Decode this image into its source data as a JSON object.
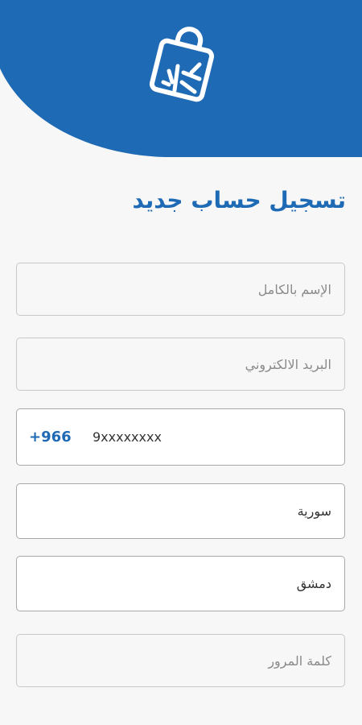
{
  "colors": {
    "primary": "#1f6ab5",
    "background": "#f7f7f7"
  },
  "header": {
    "logo_icon": "shopping-bag-sparkle-icon"
  },
  "title": "تسجيل حساب جديد",
  "form": {
    "full_name": {
      "placeholder": "الإسم بالكامل"
    },
    "email": {
      "placeholder": "البريد الالكتروني"
    },
    "phone": {
      "country_code": "+966",
      "placeholder": "9xxxxxxxx"
    },
    "country": {
      "value": "سورية"
    },
    "city": {
      "value": "دمشق"
    },
    "password": {
      "placeholder": "كلمة المرور"
    }
  }
}
